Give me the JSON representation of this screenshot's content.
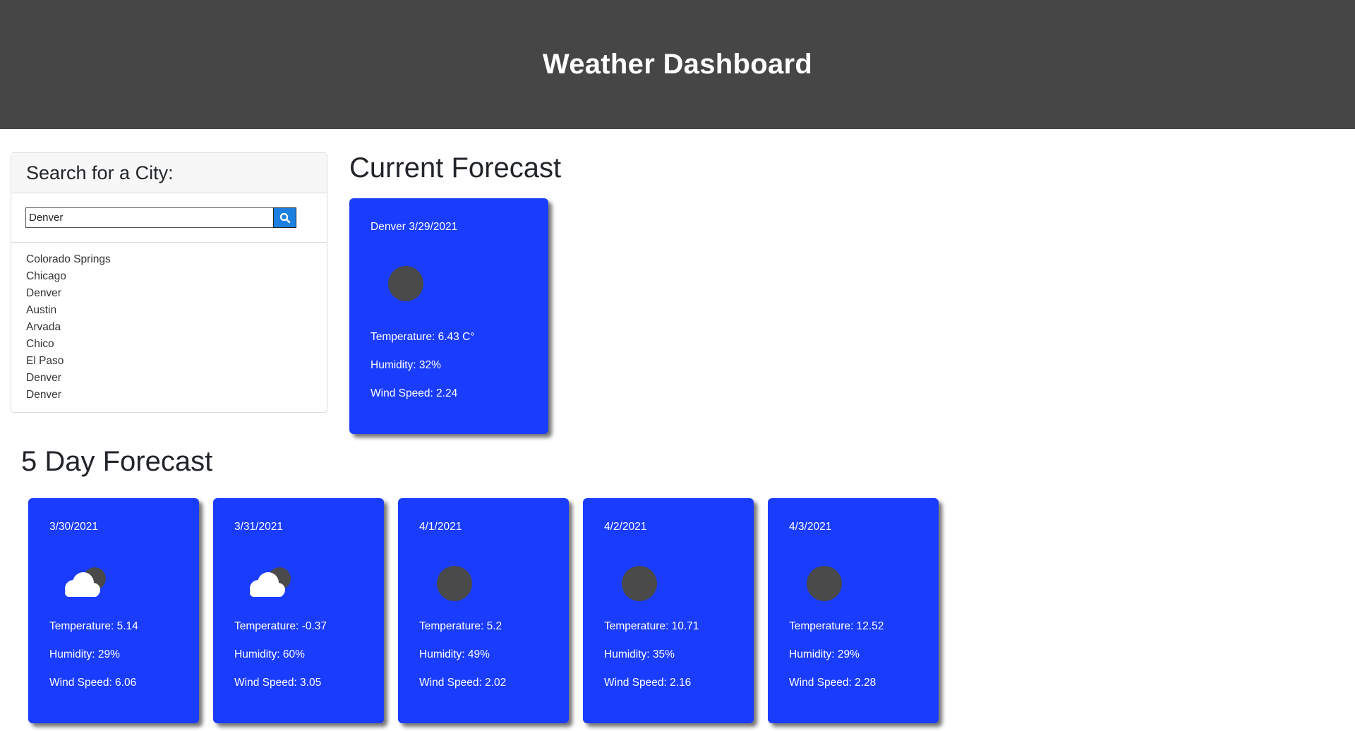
{
  "header": {
    "title": "Weather Dashboard"
  },
  "search": {
    "heading": "Search for a City:",
    "input_value": "Denver",
    "button_icon": "search-icon",
    "history": [
      "Colorado Springs",
      "Chicago",
      "Denver",
      "Austin",
      "Arvada",
      "Chico",
      "El Paso",
      "Denver",
      "Denver"
    ]
  },
  "current": {
    "heading": "Current Forecast",
    "title": "Denver 3/29/2021",
    "icon": "night-clear-icon",
    "temperature": "Temperature: 6.43 C°",
    "humidity": "Humidity: 32%",
    "wind": "Wind Speed: 2.24"
  },
  "forecast": {
    "heading": "5 Day Forecast",
    "days": [
      {
        "date": "3/30/2021",
        "icon": "night-cloudy-icon",
        "temperature": "Temperature: 5.14",
        "humidity": "Humidity: 29%",
        "wind": "Wind Speed: 6.06"
      },
      {
        "date": "3/31/2021",
        "icon": "night-cloudy-icon",
        "temperature": "Temperature: -0.37",
        "humidity": "Humidity: 60%",
        "wind": "Wind Speed: 3.05"
      },
      {
        "date": "4/1/2021",
        "icon": "night-clear-icon",
        "temperature": "Temperature: 5.2",
        "humidity": "Humidity: 49%",
        "wind": "Wind Speed: 2.02"
      },
      {
        "date": "4/2/2021",
        "icon": "night-clear-icon",
        "temperature": "Temperature: 10.71",
        "humidity": "Humidity: 35%",
        "wind": "Wind Speed: 2.16"
      },
      {
        "date": "4/3/2021",
        "icon": "night-clear-icon",
        "temperature": "Temperature: 12.52",
        "humidity": "Humidity: 29%",
        "wind": "Wind Speed: 2.28"
      }
    ]
  },
  "colors": {
    "header_bg": "#464646",
    "card_bg": "#1a3cfd",
    "search_button": "#1d7fe0"
  }
}
